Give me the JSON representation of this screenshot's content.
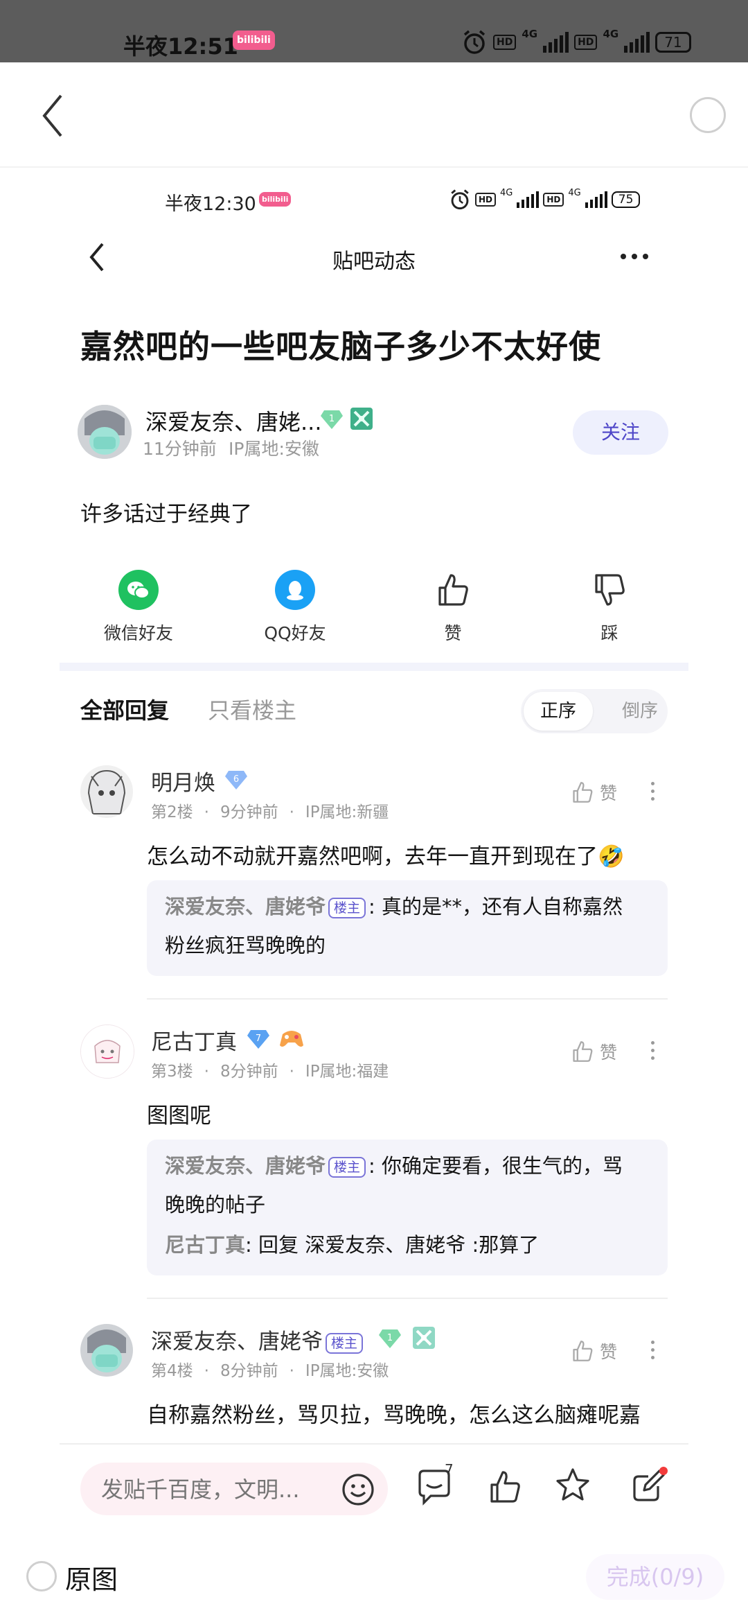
{
  "outer_status": {
    "time": "半夜12:51",
    "app_badge": "bilibili",
    "net1": "4G",
    "net2": "4G",
    "hd": "HD",
    "battery": "71"
  },
  "inner_status": {
    "time": "半夜12:30",
    "net1": "4G",
    "net2": "4G",
    "hd": "HD",
    "battery": "75"
  },
  "nav": {
    "title": "贴吧动态"
  },
  "post": {
    "title": "嘉然吧的一些吧友脑子多少不太好使",
    "author": "深爱友奈、唐姥...",
    "author_level": "1",
    "time": "11分钟前",
    "ip": "IP属地:安徽",
    "follow_label": "关注",
    "content": "许多话过于经典了"
  },
  "share": {
    "wechat": "微信好友",
    "qq": "QQ好友",
    "like": "赞",
    "dislike": "踩"
  },
  "tabs": {
    "all": "全部回复",
    "owner_only": "只看楼主",
    "order_asc": "正序",
    "order_desc": "倒序"
  },
  "comments": [
    {
      "name": "明月焕",
      "level": "6",
      "floor": "第2楼",
      "time": "9分钟前",
      "ip": "IP属地:新疆",
      "like": "赞",
      "body": "怎么动不动就开嘉然吧啊，去年一直开到现在了🤣",
      "reply_name": "深爱友奈、唐姥爷",
      "owner_tag": "楼主",
      "reply_text": ": 真的是**，还有人自称嘉然",
      "reply_text2": "粉丝疯狂骂晚晚的"
    },
    {
      "name": "尼古丁真",
      "level": "7",
      "floor": "第3楼",
      "time": "8分钟前",
      "ip": "IP属地:福建",
      "like": "赞",
      "body": "图图呢",
      "reply_name": "深爱友奈、唐姥爷",
      "owner_tag": "楼主",
      "reply_text": ": 你确定要看，很生气的，骂",
      "reply_text2": "晚晚的帖子",
      "reply2_name": "尼古丁真",
      "reply2_text": ": 回复 深爱友奈、唐姥爷 :那算了"
    },
    {
      "name": "深爱友奈、唐姥爷",
      "owner_tag": "楼主",
      "level": "1",
      "floor": "第4楼",
      "time": "8分钟前",
      "ip": "IP属地:安徽",
      "like": "赞",
      "body": "自称嘉然粉丝，骂贝拉，骂晚晚，怎么这么脑瘫呢嘉"
    }
  ],
  "bottom": {
    "input_placeholder": "发贴千百度，文明...",
    "comment_count": "7"
  },
  "footer": {
    "original_label": "原图",
    "done_label": "完成(0/9)"
  },
  "colors": {
    "accent": "#4e46c8",
    "wechat": "#1fc160",
    "qq": "#1aa1f5",
    "status_bar": "#5c5c5c"
  }
}
